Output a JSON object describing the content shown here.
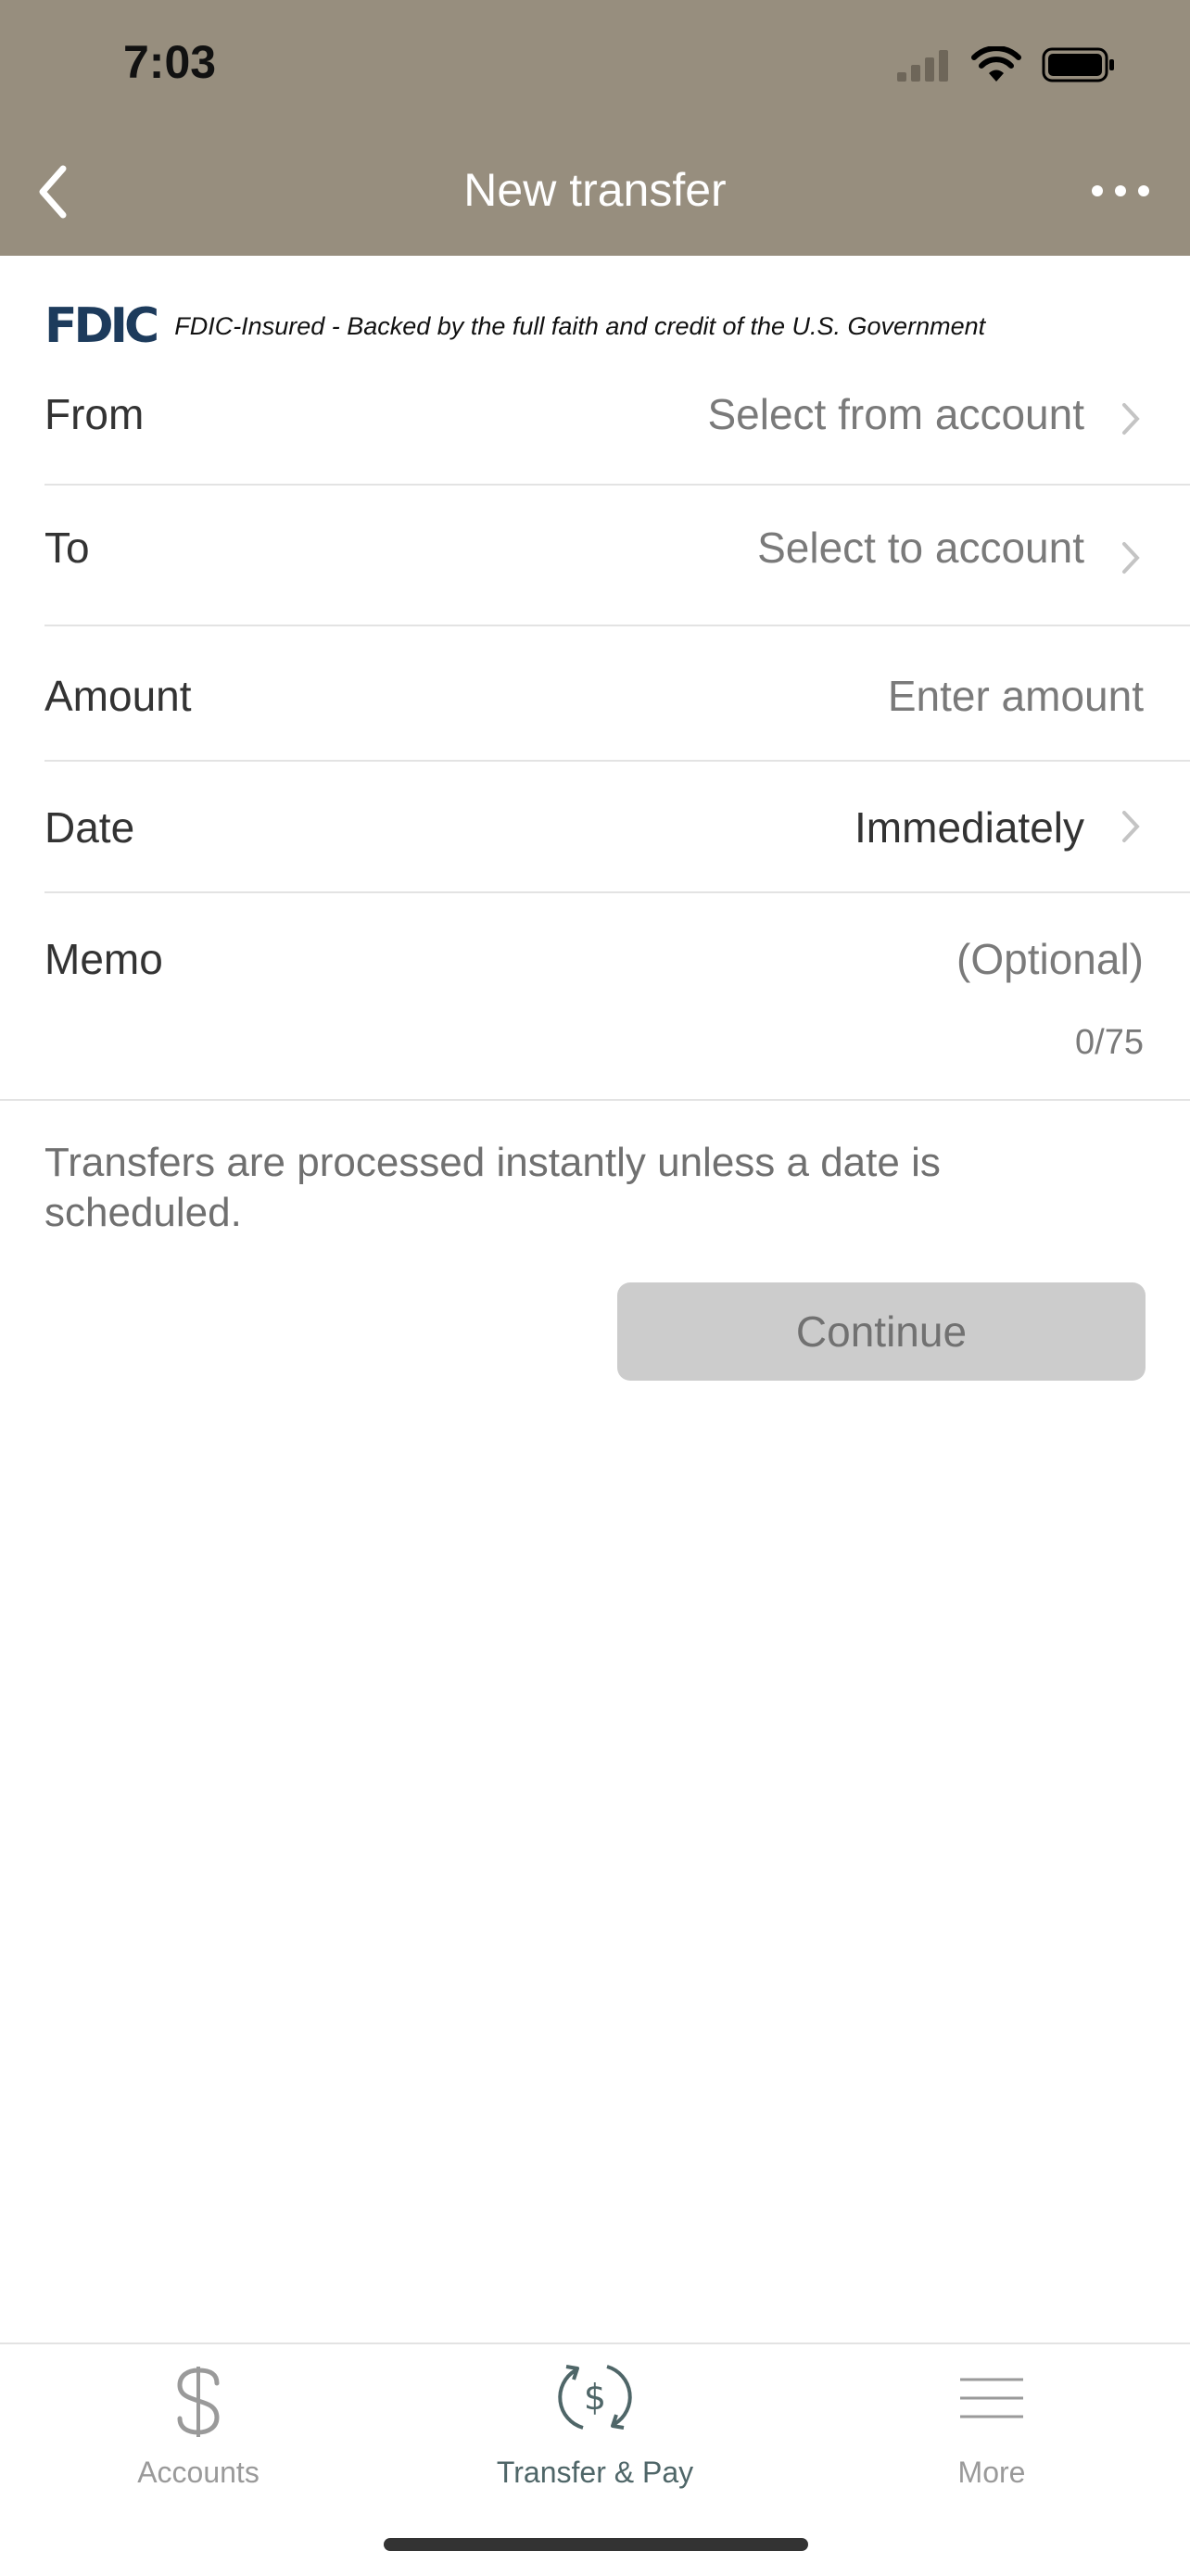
{
  "status_bar": {
    "time": "7:03"
  },
  "nav": {
    "title": "New transfer"
  },
  "fdic": {
    "logo_text": "FDIC",
    "notice": "FDIC-Insured - Backed by the full faith and credit of the U.S. Government"
  },
  "form": {
    "from": {
      "label": "From",
      "value": "Select from account"
    },
    "to": {
      "label": "To",
      "value": "Select to account"
    },
    "amount": {
      "label": "Amount",
      "placeholder": "Enter amount"
    },
    "date": {
      "label": "Date",
      "value": "Immediately"
    },
    "memo": {
      "label": "Memo",
      "placeholder": "(Optional)",
      "counter": "0/75"
    }
  },
  "info_text": "Transfers are processed instantly unless a date is scheduled.",
  "continue_label": "Continue",
  "tabs": [
    {
      "label": "Accounts",
      "icon": "dollar-icon",
      "active": false
    },
    {
      "label": "Transfer & Pay",
      "icon": "transfer-pay-icon",
      "active": true
    },
    {
      "label": "More",
      "icon": "hamburger-menu-icon",
      "active": false
    }
  ],
  "colors": {
    "header_bg": "#978e7e",
    "tab_active": "#4f6668",
    "tab_inactive": "#9a9a9a",
    "button_disabled_bg": "#cccccc",
    "fdic_blue": "#1d3b5c"
  }
}
